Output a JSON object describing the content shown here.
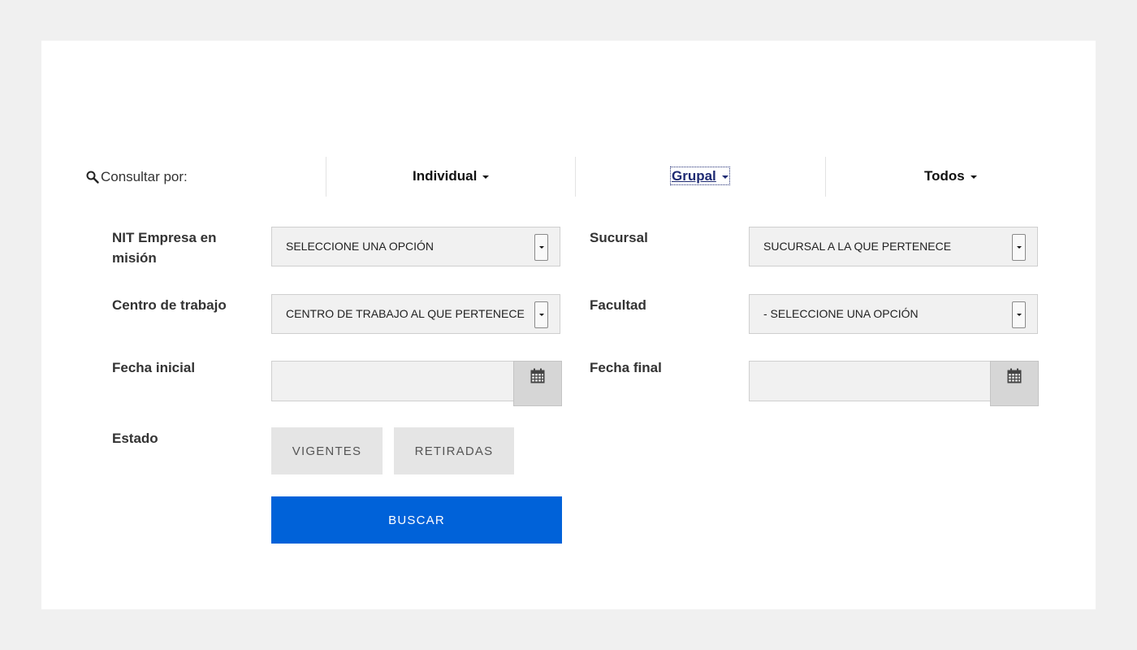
{
  "consult": {
    "label": "Consultar por:",
    "tabs": [
      {
        "label": "Individual",
        "active": false
      },
      {
        "label": "Grupal",
        "active": true
      },
      {
        "label": "Todos",
        "active": false
      }
    ]
  },
  "form": {
    "nit": {
      "label": "NIT Empresa en misión",
      "value": "SELECCIONE UNA OPCIÓN"
    },
    "sucursal": {
      "label": "Sucursal",
      "value": "SUCURSAL A LA QUE PERTENECE"
    },
    "centro": {
      "label": "Centro de trabajo",
      "value": "CENTRO DE TRABAJO AL QUE PERTENECE"
    },
    "facultad": {
      "label": "Facultad",
      "value": "- SELECCIONE UNA OPCIÓN"
    },
    "fecha_inicial": {
      "label": "Fecha inicial",
      "value": ""
    },
    "fecha_final": {
      "label": "Fecha final",
      "value": ""
    },
    "estado": {
      "label": "Estado",
      "options": [
        "VIGENTES",
        "RETIRADAS"
      ]
    },
    "search_label": "BUSCAR"
  },
  "colors": {
    "accent": "#0062d9",
    "active_tab": "#1f2b73",
    "page_bg": "#f0f0f0",
    "field_bg": "#f1f1f1"
  },
  "icons": [
    "search-icon",
    "chevron-down-icon",
    "calendar-icon"
  ]
}
